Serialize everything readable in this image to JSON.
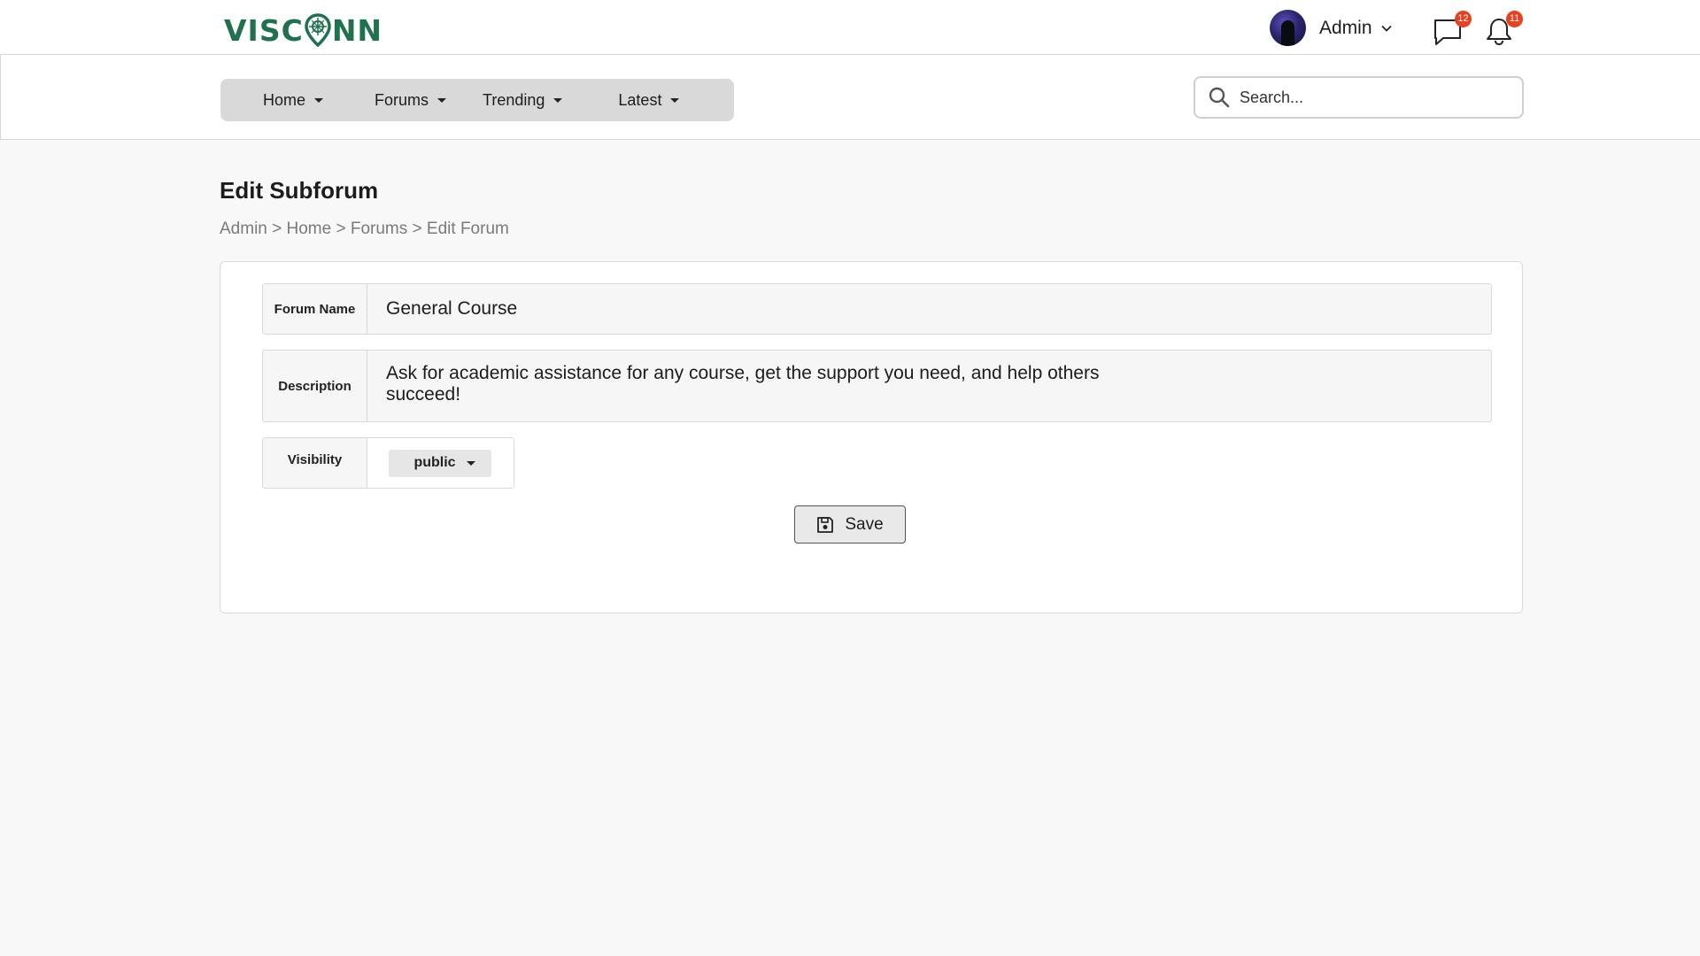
{
  "app": {
    "logo_left": "VISC",
    "logo_right": "NN",
    "brand_color": "#20724f"
  },
  "header": {
    "user_name": "Admin",
    "messages_badge": "12",
    "notifications_badge": "11",
    "badge_color": "#e8411f"
  },
  "nav": {
    "items": [
      {
        "label": "Home"
      },
      {
        "label": "Forums"
      },
      {
        "label": "Trending"
      },
      {
        "label": "Latest"
      }
    ]
  },
  "search": {
    "placeholder": "Search...",
    "value": ""
  },
  "page": {
    "title": "Edit Subforum",
    "breadcrumb": [
      "Admin",
      "Home",
      "Forums",
      "Edit Forum"
    ],
    "breadcrumb_sep": " > "
  },
  "form": {
    "forum_name_label": "Forum Name",
    "forum_name_value": "General Course",
    "description_label": "Description",
    "description_value": "Ask for academic assistance for any course, get the support you need, and help others succeed!",
    "visibility_label": "Visibility",
    "visibility_value": "public",
    "save_label": "Save"
  },
  "icons": {
    "messages": "chat-bubble-icon",
    "notifications": "bell-icon",
    "search": "search-icon",
    "save": "floppy-disk-icon",
    "user_menu": "chevron-down-icon"
  }
}
